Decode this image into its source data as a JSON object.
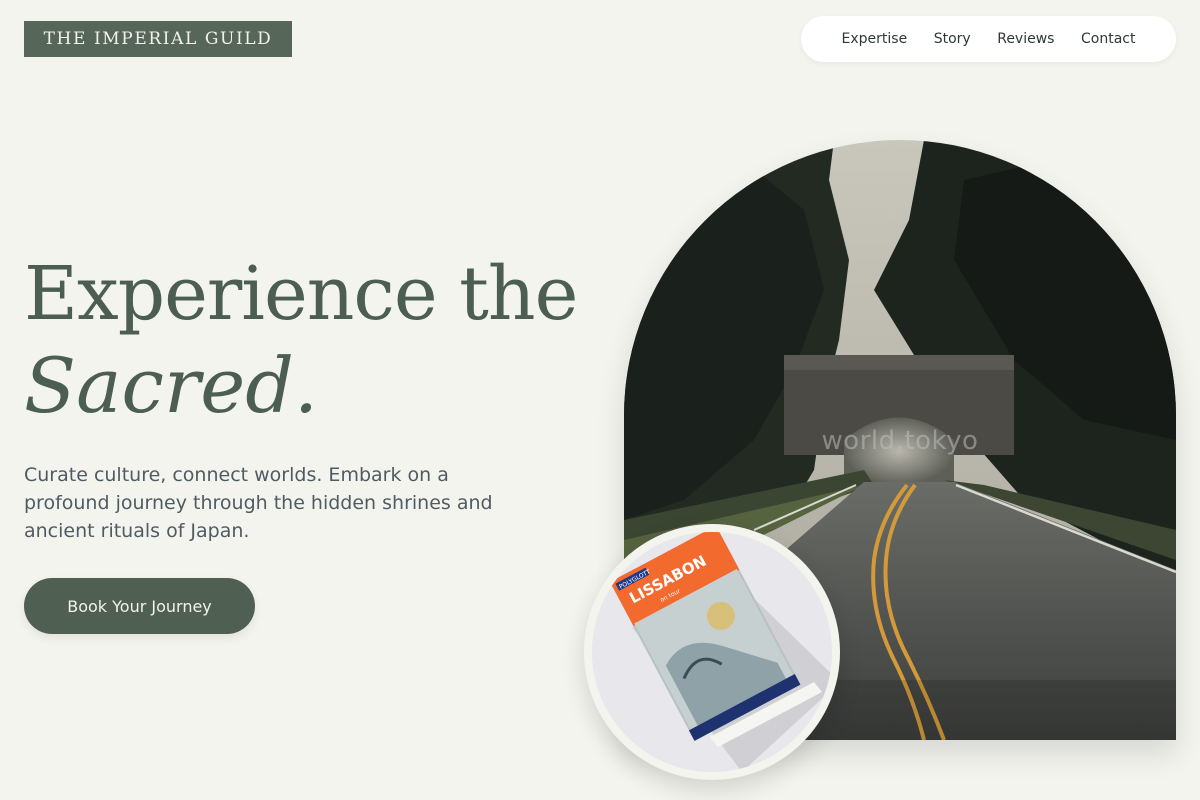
{
  "brand": {
    "logo_text": "THE IMPERIAL GUILD",
    "accent_color": "#56675a"
  },
  "nav": {
    "items": [
      {
        "label": "Expertise"
      },
      {
        "label": "Story"
      },
      {
        "label": "Reviews"
      },
      {
        "label": "Contact"
      }
    ]
  },
  "hero": {
    "headline_line1": "Experience the",
    "headline_line2": "Sacred.",
    "subtitle": "Curate culture, connect worlds. Embark on a profound journey through the hidden shrines and ancient rituals of Japan.",
    "cta_label": "Book Your Journey"
  },
  "images": {
    "arch_watermark": "world.tokyo",
    "book_publisher": "POLYGLOTT",
    "book_title": "LISSABON",
    "book_subtitle": "on tour"
  }
}
